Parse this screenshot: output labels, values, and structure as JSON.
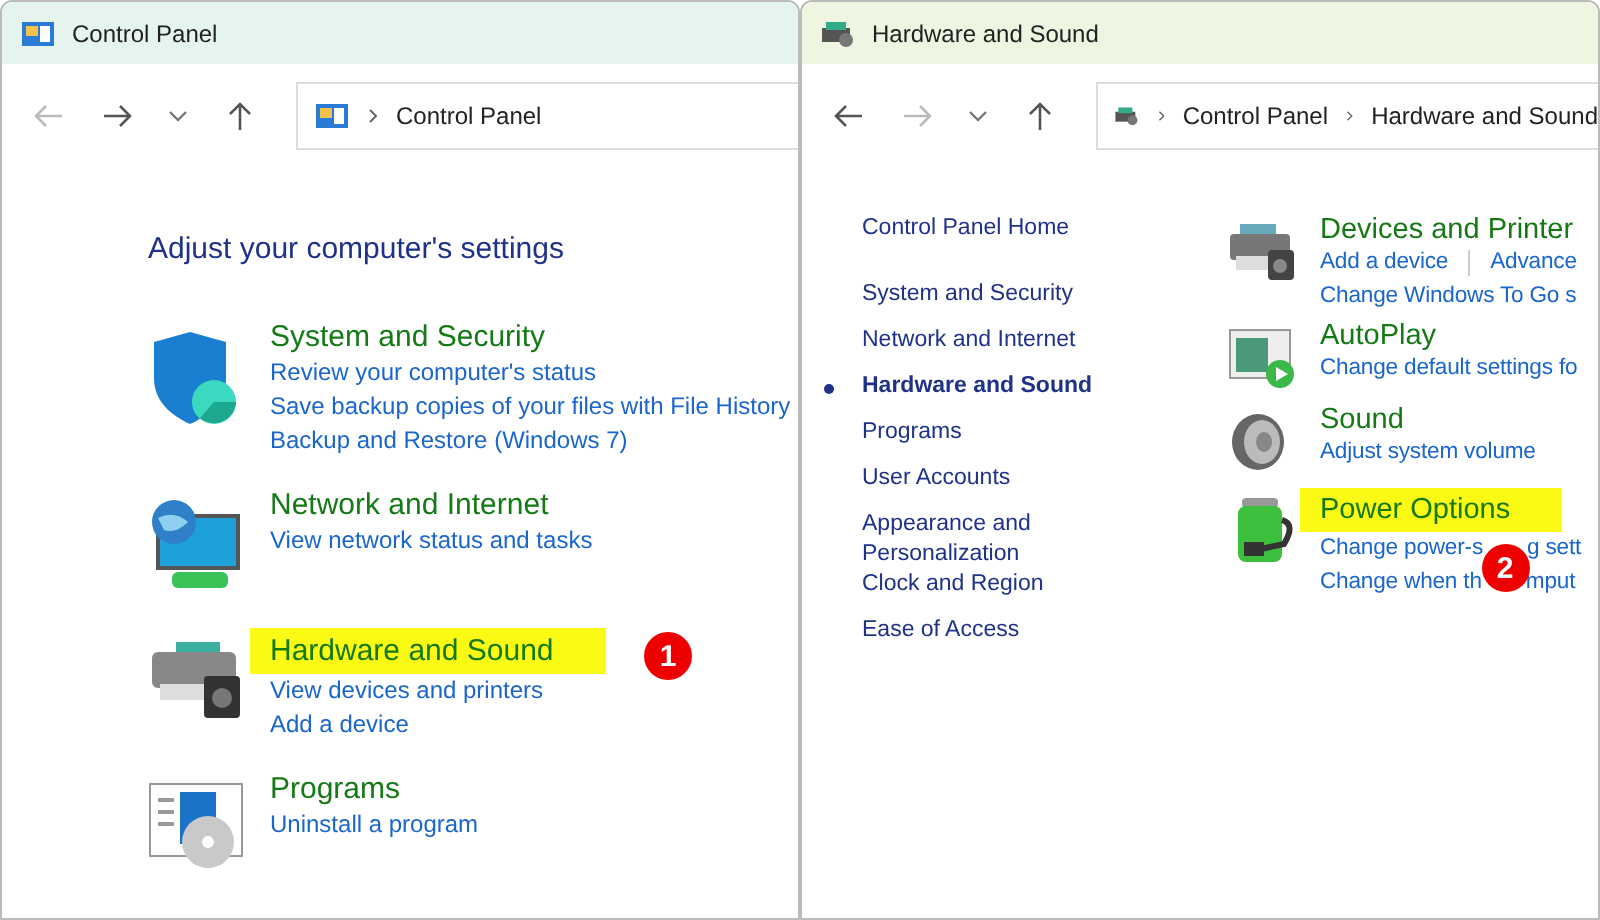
{
  "windows": [
    {
      "title": "Control Panel",
      "nav": {
        "back_disabled": true,
        "forward_disabled": false
      },
      "breadcrumb": [
        "Control Panel"
      ],
      "heading": "Adjust your computer's settings",
      "categories": [
        {
          "title": "System and Security",
          "highlighted": false,
          "links": [
            "Review your computer's status",
            "Save backup copies of your files with File History",
            "Backup and Restore (Windows 7)"
          ]
        },
        {
          "title": "Network and Internet",
          "highlighted": false,
          "links": [
            "View network status and tasks"
          ]
        },
        {
          "title": "Hardware and Sound",
          "highlighted": true,
          "badge": "1",
          "links": [
            "View devices and printers",
            "Add a device"
          ]
        },
        {
          "title": "Programs",
          "highlighted": false,
          "links": [
            "Uninstall a program"
          ]
        }
      ]
    },
    {
      "title": "Hardware and Sound",
      "nav": {
        "back_disabled": false,
        "forward_disabled": true
      },
      "breadcrumb": [
        "Control Panel",
        "Hardware and Sound"
      ],
      "sidebar": [
        {
          "label": "Control Panel Home",
          "selected": false
        },
        {
          "label": "System and Security",
          "selected": false
        },
        {
          "label": "Network and Internet",
          "selected": false
        },
        {
          "label": "Hardware and Sound",
          "selected": true
        },
        {
          "label": "Programs",
          "selected": false
        },
        {
          "label": "User Accounts",
          "selected": false
        },
        {
          "label": "Appearance and Personalization",
          "selected": false
        },
        {
          "label": "Clock and Region",
          "selected": false
        },
        {
          "label": "Ease of Access",
          "selected": false
        }
      ],
      "sections": [
        {
          "title": "Devices and Printer",
          "highlighted": false,
          "lines": [
            [
              "Add a device",
              "Advance"
            ],
            [
              "Change Windows To Go s"
            ]
          ]
        },
        {
          "title": "AutoPlay",
          "highlighted": false,
          "lines": [
            [
              "Change default settings fo"
            ]
          ]
        },
        {
          "title": "Sound",
          "highlighted": false,
          "lines": [
            [
              "Adjust system volume"
            ]
          ]
        },
        {
          "title": "Power Options",
          "highlighted": true,
          "badge": "2",
          "lines": [
            [
              "Change power-s",
              "g sett"
            ],
            [
              "Change when th",
              "mput"
            ]
          ]
        }
      ]
    }
  ]
}
